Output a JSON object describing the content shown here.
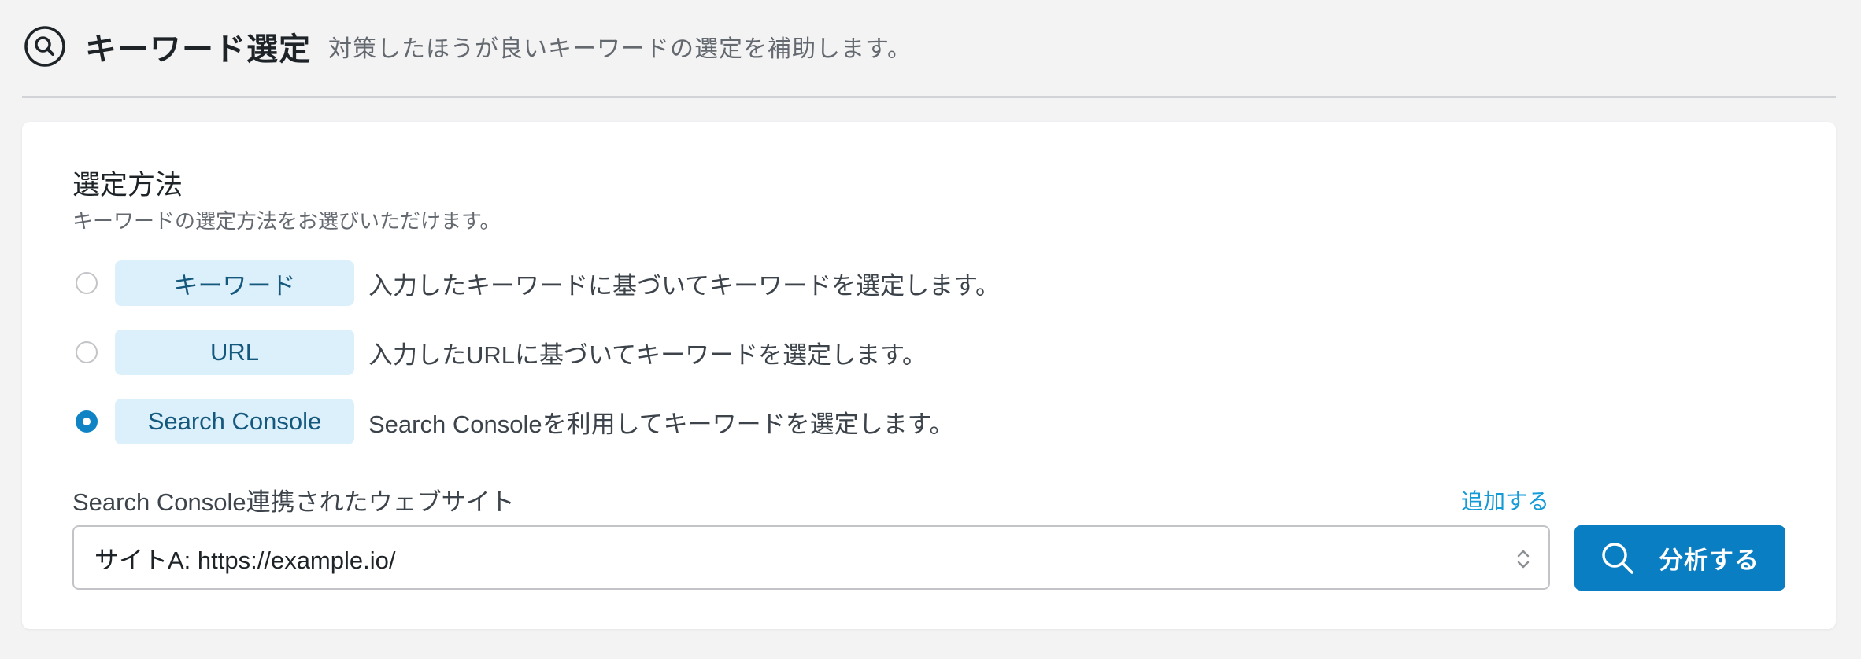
{
  "header": {
    "icon": "search-circle-icon",
    "title": "キーワード選定",
    "subtitle": "対策したほうが良いキーワードの選定を補助します。"
  },
  "selection": {
    "title": "選定方法",
    "description": "キーワードの選定方法をお選びいただけます。",
    "options": [
      {
        "badge": "キーワード",
        "description": "入力したキーワードに基づいてキーワードを選定します。",
        "selected": false
      },
      {
        "badge": "URL",
        "description": "入力したURLに基づいてキーワードを選定します。",
        "selected": false
      },
      {
        "badge": "Search Console",
        "description": "Search Consoleを利用してキーワードを選定します。",
        "selected": true
      }
    ]
  },
  "website": {
    "label": "Search Console連携されたウェブサイト",
    "add_link": "追加する",
    "selected_value": "サイトA: https://example.io/"
  },
  "analyze_button": {
    "label": "分析する",
    "icon": "search-icon"
  },
  "colors": {
    "accent": "#0a7ec2",
    "link": "#139bd8",
    "badge_bg": "#dcf0fb",
    "badge_text": "#14587e",
    "page_bg": "#f3f3f4"
  }
}
